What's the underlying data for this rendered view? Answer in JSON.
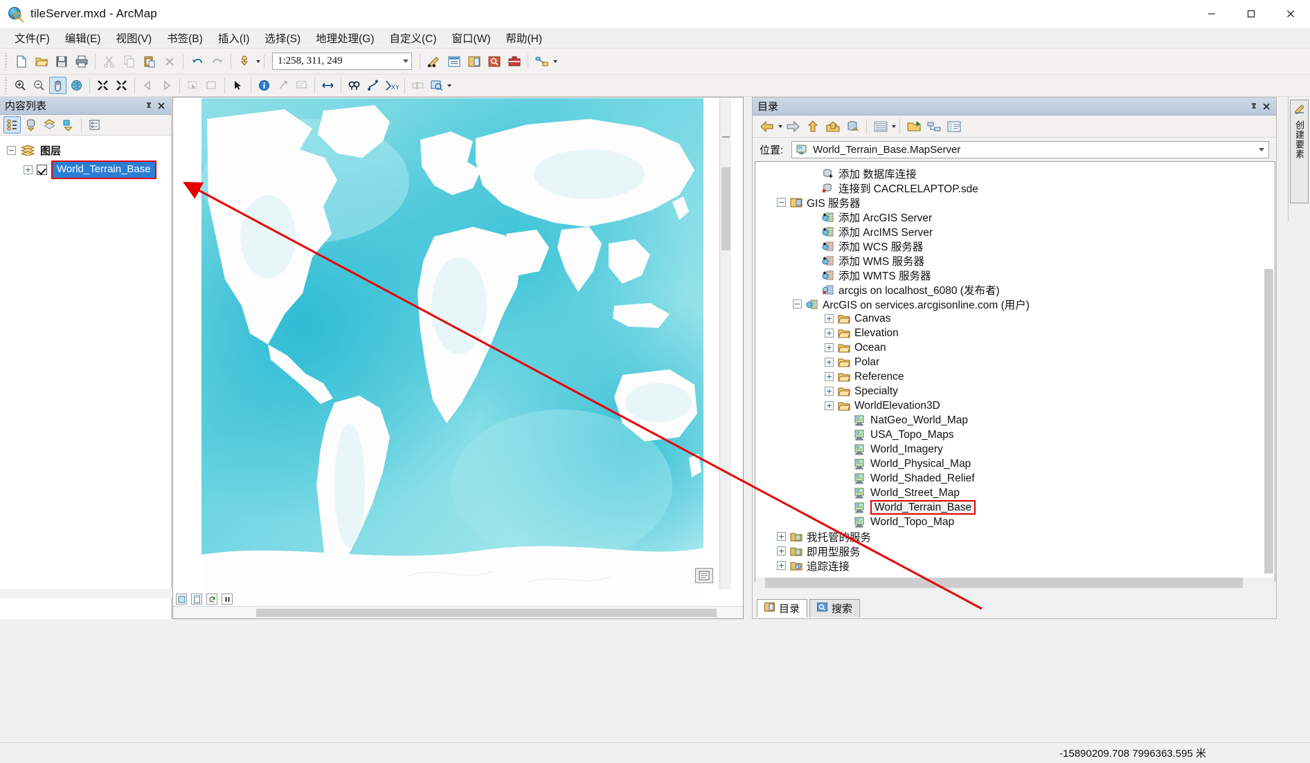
{
  "window": {
    "title": "tileServer.mxd - ArcMap",
    "app_icon": "arcmap-globe-icon",
    "minimize_label": "—",
    "maximize_label": "☐",
    "close_label": "✕"
  },
  "menubar": {
    "items": [
      {
        "label": "文件(F)",
        "name": "menu-file"
      },
      {
        "label": "编辑(E)",
        "name": "menu-edit"
      },
      {
        "label": "视图(V)",
        "name": "menu-view"
      },
      {
        "label": "书签(B)",
        "name": "menu-bookmarks"
      },
      {
        "label": "插入(I)",
        "name": "menu-insert"
      },
      {
        "label": "选择(S)",
        "name": "menu-selection"
      },
      {
        "label": "地理处理(G)",
        "name": "menu-geoprocessing"
      },
      {
        "label": "自定义(C)",
        "name": "menu-customize"
      },
      {
        "label": "窗口(W)",
        "name": "menu-windows"
      },
      {
        "label": "帮助(H)",
        "name": "menu-help"
      }
    ]
  },
  "toolbar": {
    "scale_value": "1:258, 311, 249",
    "icons_row1": [
      "new-document-icon",
      "open-folder-icon",
      "save-icon",
      "print-icon",
      "cut-icon",
      "copy-icon",
      "paste-icon",
      "delete-x-icon",
      "undo-icon",
      "redo-icon",
      "add-data-icon",
      "editor-toolbar-icon",
      "table-of-contents-icon",
      "catalog-window-icon",
      "search-window-icon",
      "arctoolbox-icon",
      "python-window-icon",
      "model-builder-icon"
    ],
    "icons_row2": [
      "zoom-in-icon",
      "zoom-out-icon",
      "pan-icon",
      "full-extent-icon",
      "fixed-zoom-in-icon",
      "fixed-zoom-out-icon",
      "go-back-extent-icon",
      "go-next-extent-icon",
      "select-features-icon",
      "clear-selection-icon",
      "select-elements-icon",
      "identify-icon",
      "hyperlink-icon",
      "html-popup-icon",
      "measure-icon",
      "find-icon",
      "find-route-icon",
      "go-to-xy-icon",
      "time-slider-icon",
      "create-viewer-window-icon"
    ]
  },
  "toc_panel": {
    "title": "内容列表",
    "toolbar_icons": [
      "list-by-drawing-order-icon",
      "list-by-source-icon",
      "list-by-visibility-icon",
      "list-by-selection-icon",
      "options-icon"
    ],
    "pin_icon": "pin-icon",
    "close_icon": "close-icon",
    "tree": {
      "root_label": "图层",
      "root_icon": "layers-icon",
      "root_expander": "−",
      "child": {
        "label": "World_Terrain_Base",
        "expander": "+",
        "checked": true,
        "selected": true,
        "highlight_color": "#2a7fd4",
        "annotation_box_color": "#e80000"
      }
    }
  },
  "map": {
    "name": "world-terrain-base-map",
    "ocean_color": "#7fd8e0",
    "deep_ocean_color": "#3fc6d8",
    "land_color": "#fdfdfd",
    "shelf_color": "#b8ecef",
    "overlay_button_icon": "data-frame-options-icon",
    "bottom_icons": [
      "data-view-icon",
      "layout-view-icon",
      "refresh-icon",
      "pause-drawing-icon"
    ]
  },
  "catalog_panel": {
    "title": "目录",
    "pin_icon": "pin-icon",
    "close_icon": "close-icon",
    "toolbar_icons": [
      "back-arrow-icon",
      "forward-arrow-icon",
      "up-one-level-icon",
      "home-folder-icon",
      "default-geodatabase-icon",
      "toggle-contents-panel-icon",
      "connect-to-folder-icon",
      "organize-toolboxes-icon",
      "item-description-icon"
    ],
    "location": {
      "label": "位置:",
      "value": "World_Terrain_Base.MapServer",
      "icon": "map-service-icon"
    },
    "tree": [
      {
        "indent": 3,
        "expander": "",
        "icon": "add-database-connection-icon",
        "label": "添加 数据库连接"
      },
      {
        "indent": 3,
        "expander": "",
        "icon": "database-broken-connection-icon",
        "label": "连接到 CACRLELAPTOP.sde"
      },
      {
        "indent": 1,
        "expander": "−",
        "icon": "gis-servers-folder-icon",
        "label": "GIS 服务器"
      },
      {
        "indent": 3,
        "expander": "",
        "icon": "add-arcgis-server-icon",
        "label": "添加 ArcGIS Server"
      },
      {
        "indent": 3,
        "expander": "",
        "icon": "add-arcims-server-icon",
        "label": "添加 ArcIMS Server"
      },
      {
        "indent": 3,
        "expander": "",
        "icon": "add-wcs-server-icon",
        "label": "添加 WCS 服务器"
      },
      {
        "indent": 3,
        "expander": "",
        "icon": "add-wms-server-icon",
        "label": "添加 WMS 服务器"
      },
      {
        "indent": 3,
        "expander": "",
        "icon": "add-wmts-server-icon",
        "label": "添加 WMTS 服务器"
      },
      {
        "indent": 3,
        "expander": "",
        "icon": "server-disconnected-icon",
        "label": "arcgis on localhost_6080 (发布者)"
      },
      {
        "indent": 2,
        "expander": "−",
        "icon": "server-connected-icon",
        "label": "ArcGIS on services.arcgisonline.com (用户)"
      },
      {
        "indent": 4,
        "expander": "+",
        "icon": "folder-icon",
        "label": "Canvas"
      },
      {
        "indent": 4,
        "expander": "+",
        "icon": "folder-icon",
        "label": "Elevation"
      },
      {
        "indent": 4,
        "expander": "+",
        "icon": "folder-icon",
        "label": "Ocean"
      },
      {
        "indent": 4,
        "expander": "+",
        "icon": "folder-icon",
        "label": "Polar"
      },
      {
        "indent": 4,
        "expander": "+",
        "icon": "folder-icon",
        "label": "Reference"
      },
      {
        "indent": 4,
        "expander": "+",
        "icon": "folder-icon",
        "label": "Specialty"
      },
      {
        "indent": 4,
        "expander": "+",
        "icon": "folder-icon",
        "label": "WorldElevation3D"
      },
      {
        "indent": 5,
        "expander": "",
        "icon": "map-service-icon",
        "label": "NatGeo_World_Map"
      },
      {
        "indent": 5,
        "expander": "",
        "icon": "map-service-icon",
        "label": "USA_Topo_Maps"
      },
      {
        "indent": 5,
        "expander": "",
        "icon": "map-service-icon",
        "label": "World_Imagery"
      },
      {
        "indent": 5,
        "expander": "",
        "icon": "map-service-icon",
        "label": "World_Physical_Map"
      },
      {
        "indent": 5,
        "expander": "",
        "icon": "map-service-icon",
        "label": "World_Shaded_Relief"
      },
      {
        "indent": 5,
        "expander": "",
        "icon": "map-service-icon",
        "label": "World_Street_Map"
      },
      {
        "indent": 5,
        "expander": "",
        "icon": "map-service-icon",
        "label": "World_Terrain_Base",
        "selected": true,
        "annotated": true
      },
      {
        "indent": 5,
        "expander": "",
        "icon": "map-service-icon",
        "label": "World_Topo_Map"
      },
      {
        "indent": 1,
        "expander": "+",
        "icon": "folder-server-icon",
        "label": "我托管的服务"
      },
      {
        "indent": 1,
        "expander": "+",
        "icon": "folder-server-icon",
        "label": "即用型服务"
      },
      {
        "indent": 1,
        "expander": "+",
        "icon": "folder-tracking-icon",
        "label": "追踪连接"
      }
    ],
    "tabs": [
      {
        "label": "目录",
        "icon": "catalog-tab-icon",
        "active": true
      },
      {
        "label": "搜索",
        "icon": "search-tab-icon",
        "active": false
      }
    ]
  },
  "right_strip": {
    "vertical_tab_label": "创建要素",
    "icon": "create-features-icon"
  },
  "annotation": {
    "arrow_color": "#e80000",
    "from": "catalog World_Terrain_Base",
    "to": "TOC World_Terrain_Base"
  },
  "statusbar": {
    "coordinates": "-15890209.708  7996363.595 米"
  }
}
